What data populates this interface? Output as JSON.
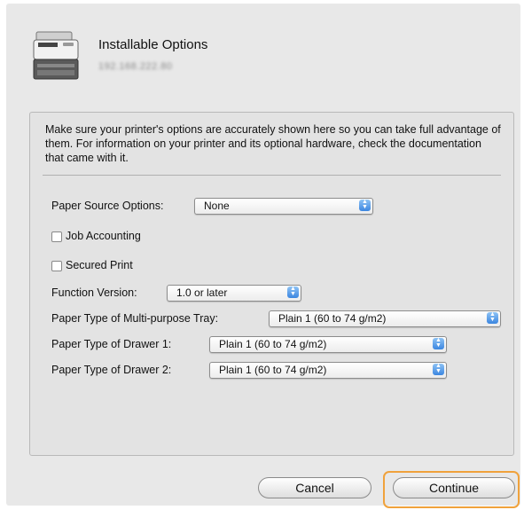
{
  "dialog": {
    "title": "Installable Options",
    "printer_address": "192.168.222.80",
    "description": "Make sure your printer's options are accurately shown here so you can take full advantage of them.  For information on your printer and its optional hardware, check the documentation that came with it."
  },
  "options": {
    "paper_source": {
      "label": "Paper Source Options:",
      "value": "None"
    },
    "job_accounting": {
      "label": "Job Accounting",
      "checked": false
    },
    "secured_print": {
      "label": "Secured Print",
      "checked": false
    },
    "function_version": {
      "label": "Function Version:",
      "value": "1.0 or later"
    },
    "mp_tray": {
      "label": "Paper Type of Multi-purpose Tray:",
      "value": "Plain 1 (60 to 74 g/m2)"
    },
    "drawer1": {
      "label": "Paper Type of Drawer 1:",
      "value": "Plain 1 (60 to 74 g/m2)"
    },
    "drawer2": {
      "label": "Paper Type of Drawer 2:",
      "value": "Plain 1 (60 to 74 g/m2)"
    }
  },
  "buttons": {
    "cancel": "Cancel",
    "continue": "Continue"
  },
  "colors": {
    "focus_ring": "#f0a23c",
    "stepper_blue": "#3b86e0"
  }
}
